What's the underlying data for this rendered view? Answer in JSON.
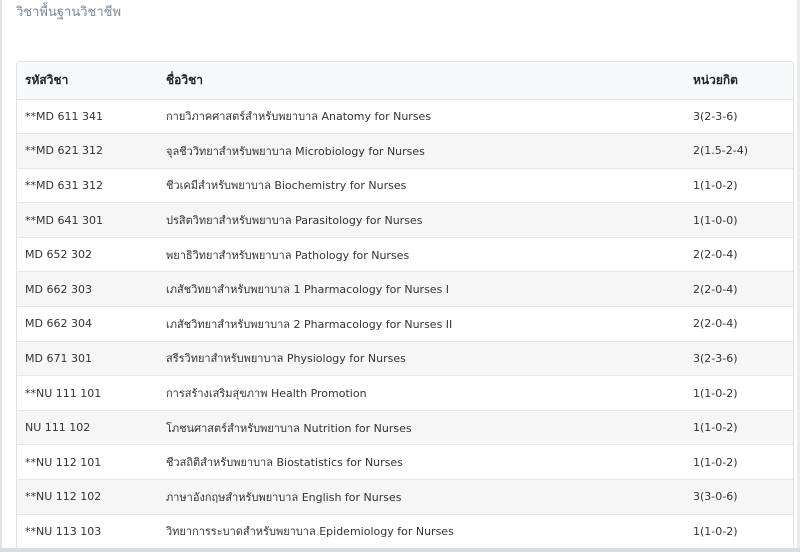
{
  "section": {
    "title": "วิชาพื้นฐานวิชาชีพ"
  },
  "table": {
    "headers": {
      "code": "รหัสวิชา",
      "name": "ชื่อวิชา",
      "credits": "หน่วยกิต"
    },
    "rows": [
      {
        "code": "**MD 611 341",
        "name": "กายวิภาคศาสตร์สำหรับพยาบาล Anatomy for Nurses",
        "credits": "3(2-3-6)"
      },
      {
        "code": "**MD 621 312",
        "name": "จุลชีววิทยาสำหรับพยาบาล Microbiology for Nurses",
        "credits": "2(1.5-2-4)"
      },
      {
        "code": "**MD 631 312",
        "name": "ชีวเคมีสำหรับพยาบาล Biochemistry for Nurses",
        "credits": "1(1-0-2)"
      },
      {
        "code": "**MD 641 301",
        "name": "ปรสิตวิทยาสำหรับพยาบาล Parasitology for Nurses",
        "credits": "1(1-0-0)"
      },
      {
        "code": "MD 652 302",
        "name": "พยาธิวิทยาสำหรับพยาบาล Pathology for Nurses",
        "credits": "2(2-0-4)"
      },
      {
        "code": "MD 662 303",
        "name": "เภสัชวิทยาสำหรับพยาบาล 1 Pharmacology for Nurses I",
        "credits": "2(2-0-4)"
      },
      {
        "code": "MD 662 304",
        "name": "เภสัชวิทยาสำหรับพยาบาล 2 Pharmacology for Nurses II",
        "credits": "2(2-0-4)"
      },
      {
        "code": "MD 671 301",
        "name": "สรีรวิทยาสำหรับพยาบาล Physiology for Nurses",
        "credits": "3(2-3-6)"
      },
      {
        "code": "**NU 111 101",
        "name": "การสร้างเสริมสุขภาพ Health Promotion",
        "credits": "1(1-0-2)"
      },
      {
        "code": "NU 111 102",
        "name": "โภชนศาสตร์สำหรับพยาบาล Nutrition for Nurses",
        "credits": "1(1-0-2)"
      },
      {
        "code": "**NU 112 101",
        "name": "ชีวสถิติสำหรับพยาบาล Biostatistics for Nurses",
        "credits": "1(1-0-2)"
      },
      {
        "code": "**NU 112 102",
        "name": "ภาษาอังกฤษสำหรับพยาบาล English for Nurses",
        "credits": "3(3-0-6)"
      },
      {
        "code": "**NU 113 103",
        "name": "วิทยาการระบาดสำหรับพยาบาล Epidemiology for Nurses",
        "credits": "1(1-0-2)"
      }
    ]
  }
}
